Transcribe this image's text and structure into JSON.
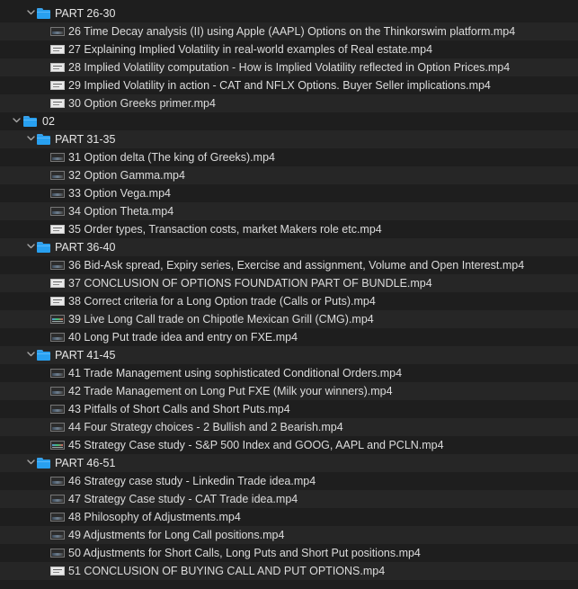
{
  "tree": [
    {
      "kind": "folder",
      "level": 1,
      "expanded": true,
      "label": "PART 26-30"
    },
    {
      "kind": "file",
      "level": 2,
      "thumb": "dark",
      "label": "26 Time Decay analysis (II) using Apple (AAPL) Options on the Thinkorswim platform.mp4"
    },
    {
      "kind": "file",
      "level": 2,
      "thumb": "light",
      "label": "27 Explaining Implied Volatility in real-world examples of Real estate.mp4"
    },
    {
      "kind": "file",
      "level": 2,
      "thumb": "light",
      "label": "28 Implied Volatility computation - How is Implied Volatility reflected in Option Prices.mp4"
    },
    {
      "kind": "file",
      "level": 2,
      "thumb": "light",
      "label": "29 Implied Volatility in action - CAT and NFLX Options. Buyer Seller implications.mp4"
    },
    {
      "kind": "file",
      "level": 2,
      "thumb": "light",
      "label": "30 Option Greeks primer.mp4"
    },
    {
      "kind": "folder",
      "level": 0,
      "expanded": true,
      "label": "02"
    },
    {
      "kind": "folder",
      "level": 1,
      "expanded": true,
      "label": "PART 31-35"
    },
    {
      "kind": "file",
      "level": 2,
      "thumb": "dark",
      "label": "31 Option delta (The king of Greeks).mp4"
    },
    {
      "kind": "file",
      "level": 2,
      "thumb": "dark",
      "label": "32 Option Gamma.mp4"
    },
    {
      "kind": "file",
      "level": 2,
      "thumb": "dark",
      "label": "33 Option Vega.mp4"
    },
    {
      "kind": "file",
      "level": 2,
      "thumb": "dark",
      "label": "34 Option Theta.mp4"
    },
    {
      "kind": "file",
      "level": 2,
      "thumb": "light",
      "label": "35 Order types, Transaction costs, market Makers role etc.mp4"
    },
    {
      "kind": "folder",
      "level": 1,
      "expanded": true,
      "label": "PART 36-40"
    },
    {
      "kind": "file",
      "level": 2,
      "thumb": "dark",
      "label": "36 Bid-Ask spread, Expiry series, Exercise and assignment, Volume and Open Interest.mp4"
    },
    {
      "kind": "file",
      "level": 2,
      "thumb": "light",
      "label": "37 CONCLUSION OF OPTIONS FOUNDATION PART OF BUNDLE.mp4"
    },
    {
      "kind": "file",
      "level": 2,
      "thumb": "light",
      "label": "38 Correct criteria for a Long Option trade (Calls or Puts).mp4"
    },
    {
      "kind": "file",
      "level": 2,
      "thumb": "chart",
      "label": "39 Live Long Call trade on Chipotle Mexican Grill (CMG).mp4"
    },
    {
      "kind": "file",
      "level": 2,
      "thumb": "dark",
      "label": "40 Long Put trade idea and entry on FXE.mp4"
    },
    {
      "kind": "folder",
      "level": 1,
      "expanded": true,
      "label": "PART 41-45"
    },
    {
      "kind": "file",
      "level": 2,
      "thumb": "dark",
      "label": "41 Trade Management using sophisticated Conditional Orders.mp4"
    },
    {
      "kind": "file",
      "level": 2,
      "thumb": "dark",
      "label": "42 Trade Management on Long Put FXE (Milk your winners).mp4"
    },
    {
      "kind": "file",
      "level": 2,
      "thumb": "dark",
      "label": "43 Pitfalls of Short Calls and Short Puts.mp4"
    },
    {
      "kind": "file",
      "level": 2,
      "thumb": "dark",
      "label": "44 Four Strategy choices - 2 Bullish and 2 Bearish.mp4"
    },
    {
      "kind": "file",
      "level": 2,
      "thumb": "chart",
      "label": "45 Strategy Case study - S&P 500 Index and GOOG, AAPL and PCLN.mp4"
    },
    {
      "kind": "folder",
      "level": 1,
      "expanded": true,
      "label": "PART 46-51"
    },
    {
      "kind": "file",
      "level": 2,
      "thumb": "dark",
      "label": "46 Strategy case study - Linkedin Trade idea.mp4"
    },
    {
      "kind": "file",
      "level": 2,
      "thumb": "dark",
      "label": "47 Strategy Case study - CAT Trade idea.mp4"
    },
    {
      "kind": "file",
      "level": 2,
      "thumb": "dark",
      "label": "48 Philosophy of Adjustments.mp4"
    },
    {
      "kind": "file",
      "level": 2,
      "thumb": "dark",
      "label": "49 Adjustments for Long Call positions.mp4"
    },
    {
      "kind": "file",
      "level": 2,
      "thumb": "dark",
      "label": "50 Adjustments for Short Calls, Long Puts and Short Put positions.mp4"
    },
    {
      "kind": "file",
      "level": 2,
      "thumb": "light",
      "label": "51 CONCLUSION OF BUYING CALL AND PUT OPTIONS.mp4"
    }
  ],
  "colors": {
    "background": "#1e1e1e",
    "alt_row": "#262626",
    "folder": "#28a0f0",
    "text": "#dcdcdc"
  },
  "icons": {
    "disclosure": "chevron-down-icon",
    "folder": "folder-icon",
    "video_thumbnail": "video-thumbnail-icon"
  }
}
